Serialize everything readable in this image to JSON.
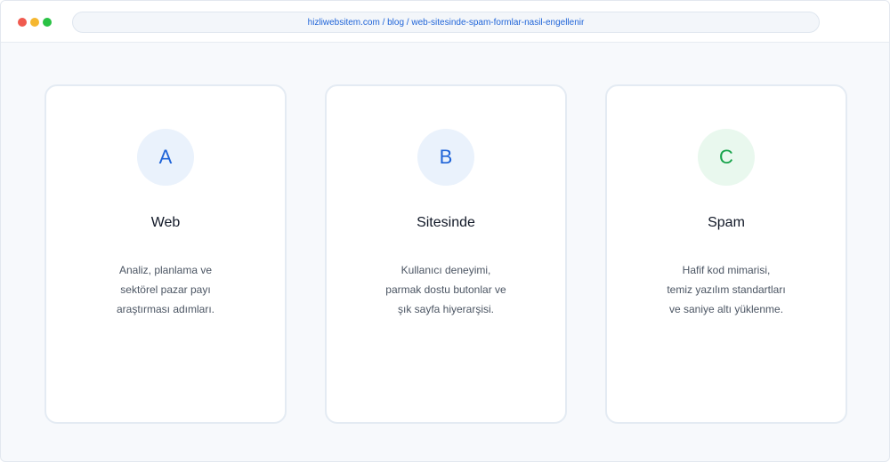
{
  "browser": {
    "url": "hizliwebsitem.com / blog / web-sitesinde-spam-formlar-nasil-engellenir"
  },
  "cards": [
    {
      "badge": "A",
      "badge_color": "#1f64d8",
      "badge_bg": "#eaf2fc",
      "title": "Web",
      "lines": [
        "Analiz, planlama ve",
        "sektörel pazar payı",
        "araştırması adımları."
      ]
    },
    {
      "badge": "B",
      "badge_color": "#1f64d8",
      "badge_bg": "#eaf2fc",
      "title": "Sitesinde",
      "lines": [
        "Kullanıcı deneyimi,",
        "parmak dostu butonlar ve",
        "şık sayfa hiyerarşisi."
      ]
    },
    {
      "badge": "C",
      "badge_color": "#16a34a",
      "badge_bg": "#e9f8ee",
      "title": "Spam",
      "lines": [
        "Hafif kod mimarisi,",
        "temiz yazılım standartları",
        "ve saniye altı yüklenme."
      ]
    }
  ]
}
